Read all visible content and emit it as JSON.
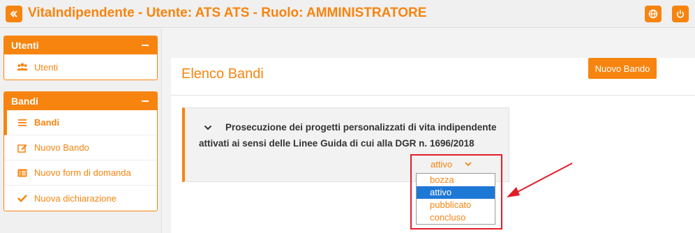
{
  "app": {
    "title": "VitaIndipendente - Utente: ATS ATS - Ruolo: AMMINISTRATORE",
    "icons": {
      "toggle": "double-chevron-left-icon",
      "language": "globe-icon",
      "logout": "power-icon"
    },
    "accent_color": "#f7840f"
  },
  "sidebar": {
    "sections": [
      {
        "title": "Utenti",
        "items": [
          {
            "label": "Utenti",
            "icon": "users-icon"
          }
        ]
      },
      {
        "title": "Bandi",
        "items": [
          {
            "label": "Bandi",
            "icon": "list-icon",
            "active": true
          },
          {
            "label": "Nuovo Bando",
            "icon": "edit-icon"
          },
          {
            "label": "Nuovo form di domanda",
            "icon": "list-alt-icon"
          },
          {
            "label": "Nuova dichiarazione",
            "icon": "check-icon"
          }
        ]
      }
    ]
  },
  "main": {
    "title": "Elenco Bandi",
    "new_button": "Nuovo Bando",
    "card": {
      "text": "Prosecuzione dei progetti personalizzati di vita indipendente attivati ai sensi delle Linee Guida di cui alla DGR n. 1696/2018",
      "status_selected": "attivo",
      "status_options": [
        "bozza",
        "attivo",
        "pubblicato",
        "concluso"
      ],
      "highlighted_option": "attivo"
    }
  },
  "annotation": {
    "color": "#e21d27"
  }
}
